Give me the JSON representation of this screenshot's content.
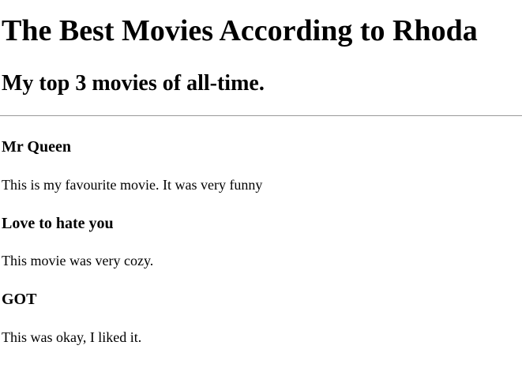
{
  "page": {
    "heading": "The Best Movies According to Rhoda",
    "subheading": "My top 3 movies of all-time."
  },
  "movies": [
    {
      "title": "Mr Queen",
      "description": "This is my favourite movie. It was very funny"
    },
    {
      "title": "Love to hate you",
      "description": "This movie was very cozy."
    },
    {
      "title": "GOT",
      "description": "This was okay, I liked it."
    }
  ]
}
